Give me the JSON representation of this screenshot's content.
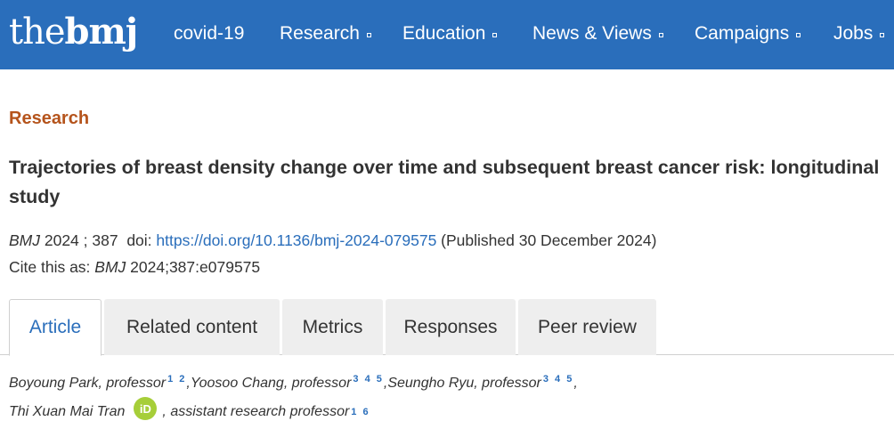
{
  "header": {
    "logo_the": "the",
    "logo_bmj": "bmj",
    "nav": [
      {
        "label": "covid-19",
        "has_menu": false
      },
      {
        "label": "Research",
        "has_menu": true
      },
      {
        "label": "Education",
        "has_menu": true
      },
      {
        "label": "News & Views",
        "has_menu": true
      },
      {
        "label": "Campaigns",
        "has_menu": true
      },
      {
        "label": "Jobs",
        "has_menu": true
      }
    ]
  },
  "article": {
    "section": "Research",
    "title": "Trajectories of breast density change over time and subsequent breast cancer risk: longitudinal study",
    "journal": "BMJ",
    "year_volume": " 2024 ; 387 ",
    "doi_label": " doi: ",
    "doi_link": "https://doi.org/10.1136/bmj-2024-079575",
    "published": " (Published 30 December 2024)",
    "cite_label": "Cite this as: ",
    "cite_journal": "BMJ",
    "cite_ref": " 2024;387:e079575"
  },
  "tabs": [
    {
      "label": "Article",
      "active": true
    },
    {
      "label": "Related content",
      "active": false
    },
    {
      "label": "Metrics",
      "active": false
    },
    {
      "label": "Responses",
      "active": false
    },
    {
      "label": "Peer review",
      "active": false
    }
  ],
  "authors": {
    "line1": [
      {
        "name": "Boyoung Park, professor",
        "aff": "1 2",
        "sep": ","
      },
      {
        "name": "Yoosoo Chang, professor",
        "aff": "3 4 5",
        "sep": ","
      },
      {
        "name": "Seungho Ryu, professor",
        "aff": "3 4 5",
        "sep": ","
      }
    ],
    "line2_name": "Thi Xuan Mai Tran",
    "orcid_label": "iD",
    "line2_role": ", assistant research professor",
    "line2_aff": "1 6"
  },
  "colors": {
    "brand_blue": "#2a6ebb",
    "section_orange": "#b5541c",
    "orcid_green": "#a6ce39"
  }
}
